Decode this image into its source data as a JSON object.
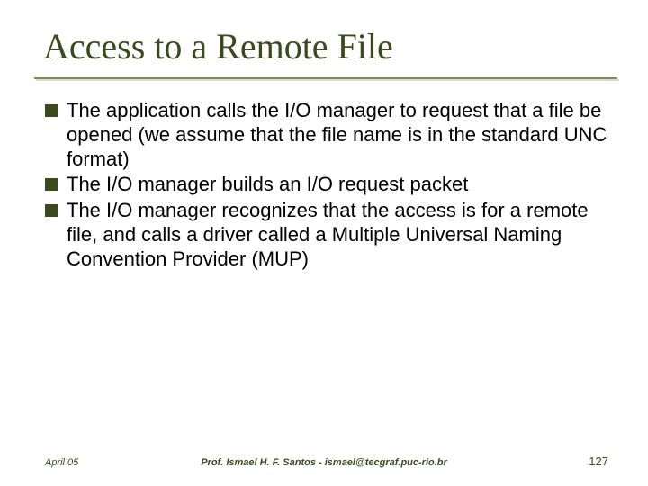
{
  "title": "Access to a Remote File",
  "bullets": [
    "The application calls the I/O manager to request that a file be opened (we assume that the file name is in the standard UNC format)",
    "The I/O manager builds an I/O request packet",
    "The I/O manager recognizes that the access is for a remote file, and calls a driver called a Multiple Universal Naming Convention Provider (MUP)"
  ],
  "footer": {
    "date": "April 05",
    "author": "Prof. Ismael H. F. Santos  -  ismael@tecgraf.puc-rio.br",
    "page": "127"
  },
  "colors": {
    "accent": "#3a4a1d",
    "underline": "#8e8450"
  }
}
